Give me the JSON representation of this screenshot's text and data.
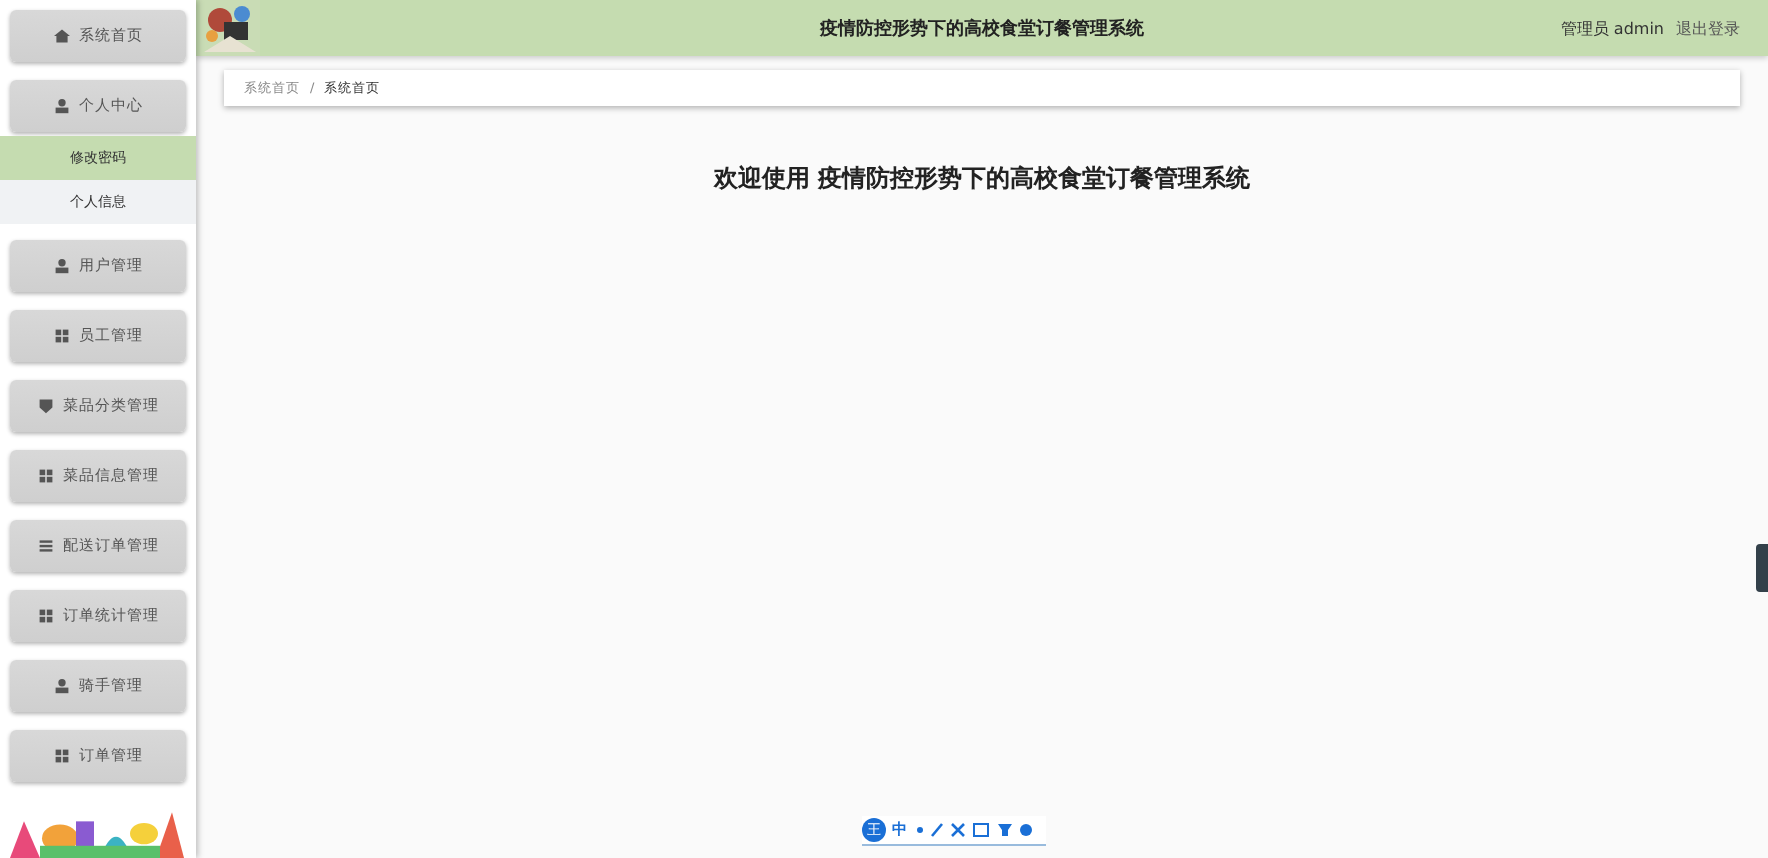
{
  "header": {
    "title": "疫情防控形势下的高校食堂订餐管理系统",
    "role": "管理员",
    "user": "admin",
    "logout": "退出登录"
  },
  "sidebar": {
    "items": [
      {
        "label": "系统首页"
      },
      {
        "label": "个人中心",
        "children": [
          {
            "label": "修改密码",
            "selected": true
          },
          {
            "label": "个人信息",
            "selected": false
          }
        ]
      },
      {
        "label": "用户管理"
      },
      {
        "label": "员工管理"
      },
      {
        "label": "菜品分类管理"
      },
      {
        "label": "菜品信息管理"
      },
      {
        "label": "配送订单管理"
      },
      {
        "label": "订单统计管理"
      },
      {
        "label": "骑手管理"
      },
      {
        "label": "订单管理"
      }
    ]
  },
  "breadcrumb": {
    "separator": "/",
    "items": [
      {
        "label": "系统首页"
      },
      {
        "label": "系统首页"
      }
    ]
  },
  "welcome": "欢迎使用 疫情防控形势下的高校食堂订餐管理系统",
  "ime_toolbar": {
    "badge": "王",
    "mode": "中"
  }
}
